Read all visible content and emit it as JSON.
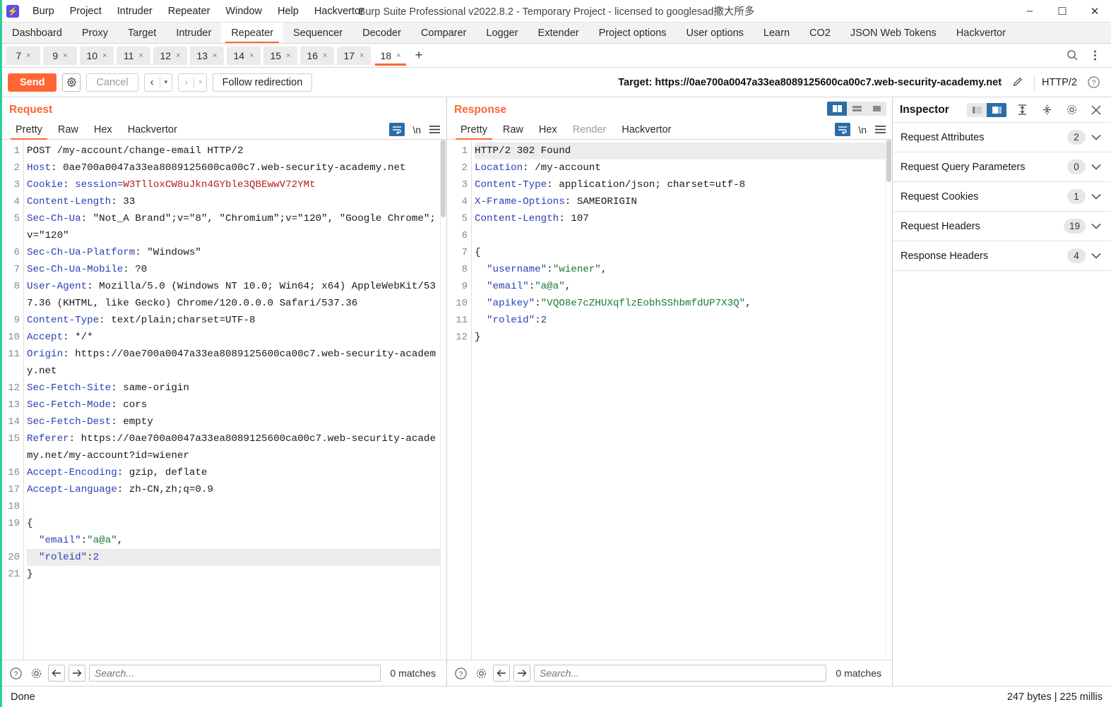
{
  "window": {
    "title": "Burp Suite Professional v2022.8.2 - Temporary Project - licensed to googlesad撒大所多",
    "minimize": "–",
    "maximize": "☐",
    "close": "✕"
  },
  "menubar": {
    "logo": "burp-logo-icon",
    "items": [
      "Burp",
      "Project",
      "Intruder",
      "Repeater",
      "Window",
      "Help",
      "Hackvertor"
    ]
  },
  "main_tabs": [
    {
      "label": "Dashboard",
      "active": false
    },
    {
      "label": "Proxy",
      "active": false
    },
    {
      "label": "Target",
      "active": false
    },
    {
      "label": "Intruder",
      "active": false
    },
    {
      "label": "Repeater",
      "active": true
    },
    {
      "label": "Sequencer",
      "active": false
    },
    {
      "label": "Decoder",
      "active": false
    },
    {
      "label": "Comparer",
      "active": false
    },
    {
      "label": "Logger",
      "active": false
    },
    {
      "label": "Extender",
      "active": false
    },
    {
      "label": "Project options",
      "active": false
    },
    {
      "label": "User options",
      "active": false
    },
    {
      "label": "Learn",
      "active": false
    },
    {
      "label": "CO2",
      "active": false
    },
    {
      "label": "JSON Web Tokens",
      "active": false
    },
    {
      "label": "Hackvertor",
      "active": false
    }
  ],
  "repeater_tabs": {
    "items": [
      {
        "label": "7",
        "active": false
      },
      {
        "label": "9",
        "active": false
      },
      {
        "label": "10",
        "active": false
      },
      {
        "label": "11",
        "active": false
      },
      {
        "label": "12",
        "active": false
      },
      {
        "label": "13",
        "active": false
      },
      {
        "label": "14",
        "active": false
      },
      {
        "label": "15",
        "active": false
      },
      {
        "label": "16",
        "active": false
      },
      {
        "label": "17",
        "active": false
      },
      {
        "label": "18",
        "active": true
      }
    ],
    "close_glyph": "×",
    "add_glyph": "+",
    "search_icon": "search-icon",
    "menu_icon": "vertical-dots-icon"
  },
  "toolbar": {
    "send_label": "Send",
    "settings_icon": "gear-icon",
    "cancel_label": "Cancel",
    "back_glyph": "‹",
    "forward_glyph": "›",
    "dropdown_glyph": "▾",
    "follow_redirection_label": "Follow redirection",
    "target_label": "Target:",
    "target_url": "https://0ae700a0047a33ea8089125600ca00c7.web-security-academy.net",
    "edit_icon": "pencil-icon",
    "http_version": "HTTP/2",
    "help_icon": "question-circle-icon"
  },
  "request": {
    "title": "Request",
    "tabs": [
      {
        "label": "Pretty",
        "active": true,
        "dim": false
      },
      {
        "label": "Raw",
        "active": false,
        "dim": false
      },
      {
        "label": "Hex",
        "active": false,
        "dim": false
      },
      {
        "label": "Hackvertor",
        "active": false,
        "dim": false
      }
    ],
    "wrap_icon": "word-wrap-icon",
    "newline_label": "\\n",
    "menu_icon": "hamburger-icon",
    "lines": [
      {
        "n": "1",
        "segs": [
          {
            "t": "POST /my-account/change-email HTTP/2",
            "c": "v"
          }
        ]
      },
      {
        "n": "2",
        "segs": [
          {
            "t": "Host",
            "c": "k"
          },
          {
            "t": ": ",
            "c": "v"
          },
          {
            "t": "0ae700a0047a33ea8089125600ca00c7.web-security-academy.net",
            "c": "v"
          }
        ],
        "wrap": true
      },
      {
        "n": "3",
        "segs": [
          {
            "t": "Cookie",
            "c": "k"
          },
          {
            "t": ": ",
            "c": "v"
          },
          {
            "t": "session=",
            "c": "k"
          },
          {
            "t": "W3TlloxCW8uJkn4GYble3QBEwwV72YMt",
            "c": "red"
          }
        ]
      },
      {
        "n": "4",
        "segs": [
          {
            "t": "Content-Length",
            "c": "k"
          },
          {
            "t": ": 33",
            "c": "v"
          }
        ]
      },
      {
        "n": "5",
        "segs": [
          {
            "t": "Sec-Ch-Ua",
            "c": "k"
          },
          {
            "t": ": \"Not_A Brand\";v=\"8\", \"Chromium\";v=\"120\", \"Google Chrome\";v=\"120\"",
            "c": "v"
          }
        ],
        "wrap": true
      },
      {
        "n": "6",
        "segs": [
          {
            "t": "Sec-Ch-Ua-Platform",
            "c": "k"
          },
          {
            "t": ": \"Windows\"",
            "c": "v"
          }
        ]
      },
      {
        "n": "7",
        "segs": [
          {
            "t": "Sec-Ch-Ua-Mobile",
            "c": "k"
          },
          {
            "t": ": ?0",
            "c": "v"
          }
        ]
      },
      {
        "n": "8",
        "segs": [
          {
            "t": "User-Agent",
            "c": "k"
          },
          {
            "t": ": Mozilla/5.0 (Windows NT 10.0; Win64; x64) AppleWebKit/537.36 (KHTML, like Gecko) Chrome/120.0.0.0 Safari/537.36",
            "c": "v"
          }
        ],
        "wrap": true
      },
      {
        "n": "9",
        "segs": [
          {
            "t": "Content-Type",
            "c": "k"
          },
          {
            "t": ": text/plain;charset=UTF-8",
            "c": "v"
          }
        ]
      },
      {
        "n": "10",
        "segs": [
          {
            "t": "Accept",
            "c": "k"
          },
          {
            "t": ": */*",
            "c": "v"
          }
        ]
      },
      {
        "n": "11",
        "segs": [
          {
            "t": "Origin",
            "c": "k"
          },
          {
            "t": ": ",
            "c": "v"
          },
          {
            "t": "https://0ae700a0047a33ea8089125600ca00c7.web-security-academy.net",
            "c": "v"
          }
        ],
        "wrap": true
      },
      {
        "n": "12",
        "segs": [
          {
            "t": "Sec-Fetch-Site",
            "c": "k"
          },
          {
            "t": ": same-origin",
            "c": "v"
          }
        ]
      },
      {
        "n": "13",
        "segs": [
          {
            "t": "Sec-Fetch-Mode",
            "c": "k"
          },
          {
            "t": ": cors",
            "c": "v"
          }
        ]
      },
      {
        "n": "14",
        "segs": [
          {
            "t": "Sec-Fetch-Dest",
            "c": "k"
          },
          {
            "t": ": empty",
            "c": "v"
          }
        ]
      },
      {
        "n": "15",
        "segs": [
          {
            "t": "Referer",
            "c": "k"
          },
          {
            "t": ": ",
            "c": "v"
          },
          {
            "t": "https://0ae700a0047a33ea8089125600ca00c7.web-security-academy.net/my-account?id=wiener",
            "c": "v"
          }
        ],
        "wrap": true
      },
      {
        "n": "16",
        "segs": [
          {
            "t": "Accept-Encoding",
            "c": "k"
          },
          {
            "t": ": gzip, deflate",
            "c": "v"
          }
        ]
      },
      {
        "n": "17",
        "segs": [
          {
            "t": "Accept-Language",
            "c": "k"
          },
          {
            "t": ": zh-CN,zh;q=0.9",
            "c": "v"
          }
        ]
      },
      {
        "n": "18",
        "segs": [
          {
            "t": "",
            "c": "v"
          }
        ]
      },
      {
        "n": "19",
        "segs": [
          {
            "t": "{",
            "c": "v"
          },
          {
            "t": "\n  \"email\"",
            "c": "k"
          },
          {
            "t": ":",
            "c": "v"
          },
          {
            "t": "\"a@a\"",
            "c": "grn"
          },
          {
            "t": ",",
            "c": "v"
          }
        ],
        "wrap": true
      },
      {
        "n": "20",
        "segs": [
          {
            "t": "  \"roleid\"",
            "c": "k"
          },
          {
            "t": ":",
            "c": "v"
          },
          {
            "t": "2",
            "c": "blu"
          }
        ],
        "hl": true
      },
      {
        "n": "21",
        "segs": [
          {
            "t": "}",
            "c": "v"
          }
        ]
      }
    ],
    "search_placeholder": "Search...",
    "matches": "0 matches",
    "help_icon": "question-circle-icon",
    "settings_icon": "gear-icon",
    "prev_icon": "arrow-left-icon",
    "next_icon": "arrow-right-icon"
  },
  "response": {
    "title": "Response",
    "tabs": [
      {
        "label": "Pretty",
        "active": true,
        "dim": false
      },
      {
        "label": "Raw",
        "active": false,
        "dim": false
      },
      {
        "label": "Hex",
        "active": false,
        "dim": false
      },
      {
        "label": "Render",
        "active": false,
        "dim": true
      },
      {
        "label": "Hackvertor",
        "active": false,
        "dim": false
      }
    ],
    "viewmodes": [
      {
        "name": "split-vertical-view",
        "active": true
      },
      {
        "name": "split-horizontal-view",
        "active": false
      },
      {
        "name": "single-pane-view",
        "active": false
      }
    ],
    "wrap_icon": "word-wrap-icon",
    "newline_label": "\\n",
    "menu_icon": "hamburger-icon",
    "lines": [
      {
        "n": "1",
        "segs": [
          {
            "t": "HTTP/2 302 Found",
            "c": "v"
          }
        ],
        "hl": true
      },
      {
        "n": "2",
        "segs": [
          {
            "t": "Location",
            "c": "k"
          },
          {
            "t": ": /my-account",
            "c": "v"
          }
        ]
      },
      {
        "n": "3",
        "segs": [
          {
            "t": "Content-Type",
            "c": "k"
          },
          {
            "t": ": application/json; charset=utf-8",
            "c": "v"
          }
        ]
      },
      {
        "n": "4",
        "segs": [
          {
            "t": "X-Frame-Options",
            "c": "k"
          },
          {
            "t": ": SAMEORIGIN",
            "c": "v"
          }
        ]
      },
      {
        "n": "5",
        "segs": [
          {
            "t": "Content-Length",
            "c": "k"
          },
          {
            "t": ": 107",
            "c": "v"
          }
        ]
      },
      {
        "n": "6",
        "segs": [
          {
            "t": "",
            "c": "v"
          }
        ]
      },
      {
        "n": "7",
        "segs": [
          {
            "t": "{",
            "c": "v"
          }
        ]
      },
      {
        "n": "8",
        "segs": [
          {
            "t": "  \"username\"",
            "c": "k"
          },
          {
            "t": ":",
            "c": "v"
          },
          {
            "t": "\"wiener\"",
            "c": "grn"
          },
          {
            "t": ",",
            "c": "v"
          }
        ]
      },
      {
        "n": "9",
        "segs": [
          {
            "t": "  \"email\"",
            "c": "k"
          },
          {
            "t": ":",
            "c": "v"
          },
          {
            "t": "\"a@a\"",
            "c": "grn"
          },
          {
            "t": ",",
            "c": "v"
          }
        ]
      },
      {
        "n": "10",
        "segs": [
          {
            "t": "  \"apikey\"",
            "c": "k"
          },
          {
            "t": ":",
            "c": "v"
          },
          {
            "t": "\"VQO8e7cZHUXqflzEobhSShbmfdUP7X3Q\"",
            "c": "grn"
          },
          {
            "t": ",",
            "c": "v"
          }
        ]
      },
      {
        "n": "11",
        "segs": [
          {
            "t": "  \"roleid\"",
            "c": "k"
          },
          {
            "t": ":",
            "c": "v"
          },
          {
            "t": "2",
            "c": "blu"
          }
        ]
      },
      {
        "n": "12",
        "segs": [
          {
            "t": "}",
            "c": "v"
          }
        ]
      }
    ],
    "search_placeholder": "Search...",
    "matches": "0 matches",
    "help_icon": "question-circle-icon",
    "settings_icon": "gear-icon",
    "prev_icon": "arrow-left-icon",
    "next_icon": "arrow-right-icon"
  },
  "inspector": {
    "title": "Inspector",
    "viewmodes": [
      {
        "name": "inspector-dock-left",
        "active": false
      },
      {
        "name": "inspector-dock-right",
        "active": true
      }
    ],
    "expand_all_icon": "expand-all-icon",
    "collapse_all_icon": "collapse-all-icon",
    "settings_icon": "gear-icon",
    "close_icon": "close-icon",
    "sections": [
      {
        "label": "Request Attributes",
        "count": "2"
      },
      {
        "label": "Request Query Parameters",
        "count": "0"
      },
      {
        "label": "Request Cookies",
        "count": "1"
      },
      {
        "label": "Request Headers",
        "count": "19"
      },
      {
        "label": "Response Headers",
        "count": "4"
      }
    ],
    "chevron": "⌄"
  },
  "statusbar": {
    "left": "Done",
    "right": "247 bytes | 225 millis"
  },
  "colors": {
    "accent": "#ff6633",
    "header_key": "#2a3fb5",
    "cookie_value": "#b02020",
    "json_string": "#1a7a35",
    "selected_blue": "#2c6da8",
    "edge_green": "#2ecc9b"
  }
}
